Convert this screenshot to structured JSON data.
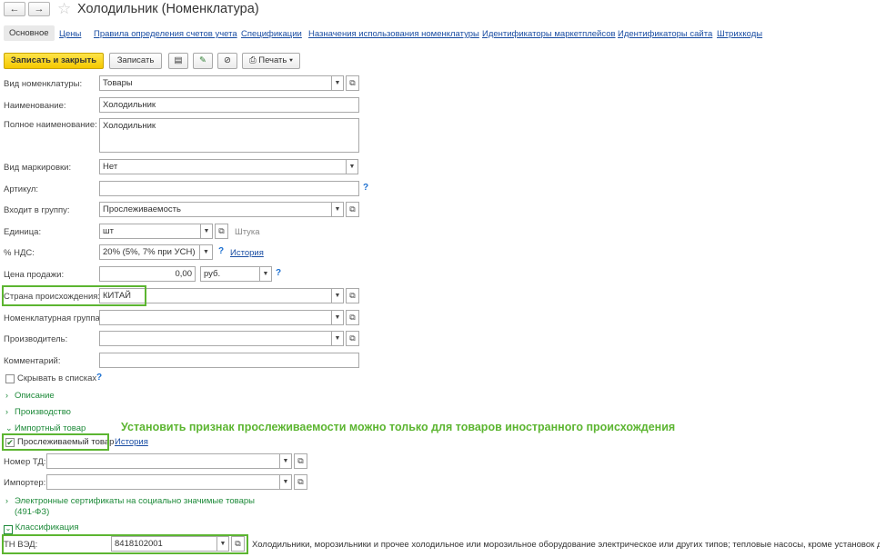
{
  "window": {
    "title": "Холодильник (Номенклатура)",
    "nav": {
      "back_icon": "←",
      "forward_icon": "→",
      "star_icon": "☆"
    }
  },
  "tabs": [
    "Основное",
    "Цены",
    "Правила определения счетов учета",
    "Спецификации",
    "Назначения использования номенклатуры",
    "Идентификаторы маркетплейсов",
    "Идентификаторы сайта",
    "Штрихкоды"
  ],
  "toolbar": {
    "save_close": "Записать и закрыть",
    "save": "Записать",
    "print": "Печать",
    "print_arrow": "▾",
    "icons": {
      "report": "▤",
      "edit": "✎",
      "attach": "⊘",
      "printer": "⎙"
    }
  },
  "form": {
    "kind": {
      "label": "Вид номенклатуры:",
      "value": "Товары"
    },
    "name": {
      "label": "Наименование:",
      "value": "Холодильник"
    },
    "full_name": {
      "label": "Полное наименование:",
      "value": "Холодильник"
    },
    "marking": {
      "label": "Вид маркировки:",
      "value": "Нет"
    },
    "article": {
      "label": "Артикул:",
      "value": ""
    },
    "group": {
      "label": "Входит в группу:",
      "value": "Прослеживаемость"
    },
    "unit": {
      "label": "Единица:",
      "value": "шт",
      "hint": "Штука"
    },
    "vat": {
      "label": "% НДС:",
      "value": "20% (5%, 7% при УСН)",
      "history": "История"
    },
    "price": {
      "label": "Цена продажи:",
      "value": "0,00",
      "currency": "руб."
    },
    "country": {
      "label": "Страна происхождения:",
      "value": "КИТАЙ"
    },
    "nom_group": {
      "label": "Номенклатурная группа:",
      "value": ""
    },
    "producer": {
      "label": "Производитель:",
      "value": ""
    },
    "comment": {
      "label": "Комментарий:",
      "value": ""
    },
    "hide_in_lists": {
      "label": "Скрывать в списках",
      "checked": false
    }
  },
  "sections": {
    "description": "Описание",
    "production": "Производство",
    "import": "Импортный товар",
    "certificates_line1": "Электронные сертификаты на социально значимые товары",
    "certificates_line2": "(491-ФЗ)",
    "classification": "Классификация"
  },
  "import": {
    "traceable": {
      "label": "Прослеживаемый товар",
      "checked": true,
      "history": "История"
    },
    "customs_number": {
      "label": "Номер ТД:",
      "value": ""
    },
    "importer": {
      "label": "Импортер:",
      "value": ""
    }
  },
  "classification": {
    "tnved": {
      "label": "ТН ВЭД:",
      "value": "8418102001",
      "description": "Холодильники, морозильники и прочее холодильное или морозильное оборудование электрическое или других типов; тепловые насосы, кроме установок для конд"
    }
  },
  "annotation": "Установить признак прослеживаемости можно только для товаров иностранного происхождения",
  "glyphs": {
    "dropdown": "▼",
    "open": "⧉",
    "help": "?",
    "chevron_right": "›",
    "chevron_down": "⌄",
    "check": "✔"
  },
  "colors": {
    "accent_yellow": "#f5c800",
    "link_blue": "#1b4ea3",
    "section_green": "#1e8a3a",
    "highlight_green": "#5cb531"
  }
}
